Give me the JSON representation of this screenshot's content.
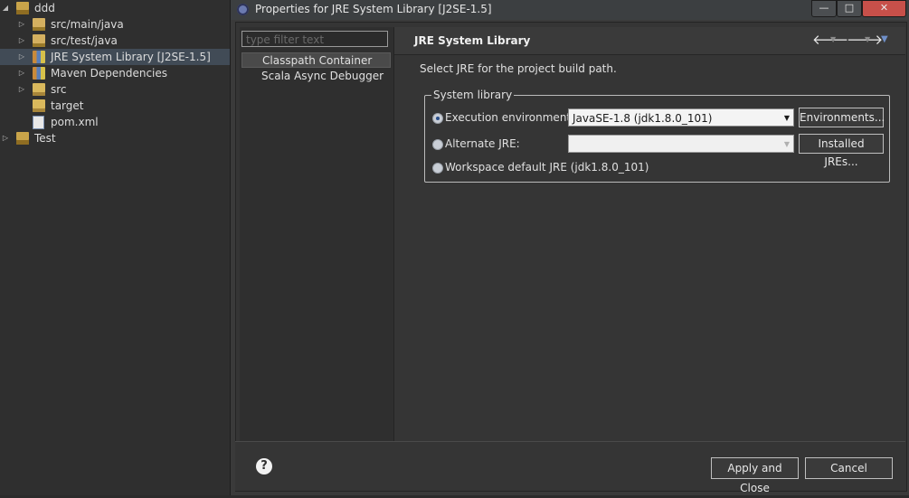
{
  "explorer": {
    "items": [
      {
        "label": "ddd",
        "icon": "project-folder-icon",
        "twisty": "expanded",
        "depth": 0
      },
      {
        "label": "src/main/java",
        "icon": "package-folder-icon",
        "twisty": "collapsed",
        "depth": 1
      },
      {
        "label": "src/test/java",
        "icon": "package-folder-icon",
        "twisty": "collapsed",
        "depth": 1
      },
      {
        "label": "JRE System Library [J2SE-1.5]",
        "icon": "library-icon",
        "twisty": "collapsed",
        "depth": 1,
        "selected": true
      },
      {
        "label": "Maven Dependencies",
        "icon": "library-icon",
        "twisty": "collapsed",
        "depth": 1
      },
      {
        "label": "src",
        "icon": "folder-icon",
        "twisty": "collapsed",
        "depth": 1
      },
      {
        "label": "target",
        "icon": "folder-icon",
        "twisty": "none",
        "depth": 1
      },
      {
        "label": "pom.xml",
        "icon": "xml-file-icon",
        "twisty": "none",
        "depth": 1
      },
      {
        "label": "Test",
        "icon": "project-folder-icon",
        "twisty": "collapsed",
        "depth": 0
      }
    ]
  },
  "dialog": {
    "title": "Properties for JRE System Library [J2SE-1.5]",
    "window_buttons": {
      "minimize": "—",
      "maximize": "□",
      "close": "✕"
    },
    "filter_placeholder": "type filter text",
    "nav": [
      {
        "label": "Classpath Container",
        "selected": true
      },
      {
        "label": "Scala Async Debugger",
        "selected": false
      }
    ],
    "page_title": "JRE System Library",
    "description": "Select JRE for the project build path.",
    "group_title": "System library",
    "options": {
      "execution_env_label": "Execution environment:",
      "execution_env_value": "JavaSE-1.8 (jdk1.8.0_101)",
      "environments_button": "Environments...",
      "alternate_jre_label": "Alternate JRE:",
      "alternate_jre_value": "",
      "installed_jres_button": "Installed JREs...",
      "workspace_default_label": "Workspace default JRE (jdk1.8.0_101)",
      "selected": "execution_environment"
    },
    "footer": {
      "help": "?",
      "apply_close": "Apply and Close",
      "cancel": "Cancel"
    },
    "nav_arrows": {
      "back": "🡐",
      "forward": "🡒",
      "menu": "▼",
      "drop": "▼"
    }
  },
  "colors": {
    "background": "#2b2b2b",
    "dialog": "#353535",
    "selection": "#414b56",
    "close_button": "#c7504a"
  }
}
